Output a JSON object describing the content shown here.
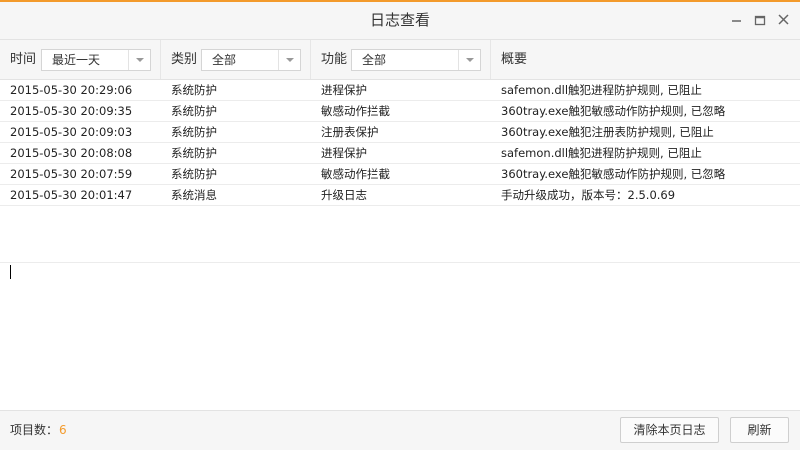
{
  "window": {
    "title": "日志查看",
    "accent_color": "#f39a2b"
  },
  "window_controls": {
    "minimize_icon": "minimize-icon",
    "maximize_icon": "maximize-icon",
    "close_icon": "close-icon"
  },
  "filters": {
    "time": {
      "label": "时间",
      "value": "最近一天"
    },
    "category": {
      "label": "类别",
      "value": "全部"
    },
    "function": {
      "label": "功能",
      "value": "全部"
    },
    "summary": {
      "label": "概要"
    }
  },
  "logs": [
    {
      "time": "2015-05-30 20:29:06",
      "category": "系统防护",
      "function": "进程保护",
      "summary": "safemon.dll触犯进程防护规则, 已阻止"
    },
    {
      "time": "2015-05-30 20:09:35",
      "category": "系统防护",
      "function": "敏感动作拦截",
      "summary": "360tray.exe触犯敏感动作防护规则, 已忽略"
    },
    {
      "time": "2015-05-30 20:09:03",
      "category": "系统防护",
      "function": "注册表保护",
      "summary": "360tray.exe触犯注册表防护规则, 已阻止"
    },
    {
      "time": "2015-05-30 20:08:08",
      "category": "系统防护",
      "function": "进程保护",
      "summary": "safemon.dll触犯进程防护规则, 已阻止"
    },
    {
      "time": "2015-05-30 20:07:59",
      "category": "系统防护",
      "function": "敏感动作拦截",
      "summary": "360tray.exe触犯敏感动作防护规则, 已忽略"
    },
    {
      "time": "2015-05-30 20:01:47",
      "category": "系统消息",
      "function": "升级日志",
      "summary": "手动升级成功，版本号：2.5.0.69"
    }
  ],
  "footer": {
    "count_label": "项目数：",
    "count_value": "6",
    "clear_button": "清除本页日志",
    "refresh_button": "刷新"
  }
}
